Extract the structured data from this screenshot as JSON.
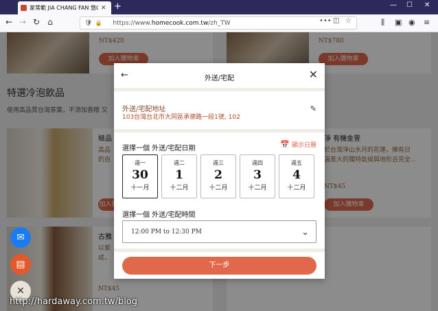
{
  "browser": {
    "tab_title": "家常範 JIA CHANG FAN 悠Gift",
    "url_prefix": "https://www.",
    "url_domain": "homecook.com.tw",
    "url_suffix": "/zh_TW"
  },
  "page": {
    "price_top_left": "NT$420",
    "price_top_right": "NT$780",
    "add_to_cart": "加入購物車",
    "section_title": "特選冷泡飲品",
    "section_subtitle": "使用高品質台灣茶葉，不添加香精 又",
    "product_left_title": "極品",
    "product_left_text1": "高品",
    "product_left_text2": "的自",
    "product_right_title": "淨 有機金萱",
    "product_right_text1": "於台灣淨山水月的花蓮，擁有日",
    "product_right_text2": "溫差大的獨特氣候與地形且完全...",
    "price_mid_right": "NT$45",
    "product_left2_title": "古雅",
    "product_left2_text1": "以紫",
    "product_left2_text2": "成，",
    "price_bottom_left": "NT$45"
  },
  "modal": {
    "title": "外送/宅配",
    "address_label": "外送/宅配地址",
    "address_text": "103台灣台北市大同區承德路一段1號, 102",
    "date_label": "選擇一個 外送/宅配日期",
    "show_calendar": "顯示日曆",
    "days": [
      {
        "weekday": "週一",
        "date": "30",
        "month": "十一月"
      },
      {
        "weekday": "週二",
        "date": "1",
        "month": "十二月"
      },
      {
        "weekday": "週三",
        "date": "2",
        "month": "十二月"
      },
      {
        "weekday": "週四",
        "date": "3",
        "month": "十二月"
      },
      {
        "weekday": "週五",
        "date": "4",
        "month": "十二月"
      }
    ],
    "time_label": "選擇一個 外送/宅配時間",
    "time_value": "12:00 PM to 12:30 PM",
    "next_button": "下一步"
  },
  "watermark": "http://hardaway.com.tw/blog",
  "colors": {
    "accent": "#e0694c",
    "tabbar": "#2b2a5a"
  }
}
